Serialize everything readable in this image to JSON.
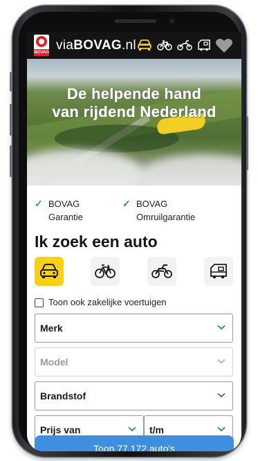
{
  "header": {
    "brand_prefix": "via",
    "brand_main": "BOVAG",
    "brand_suffix": ".nl",
    "logo_text": "BOVAG",
    "icons": [
      "car-icon",
      "bicycle-icon",
      "motorcycle-icon",
      "camper-icon",
      "heart-icon"
    ],
    "accent_color": "#f7d117"
  },
  "hero": {
    "line1": "De helpende hand",
    "line2": "van rijdend Nederland"
  },
  "usps": [
    {
      "line1": "BOVAG",
      "line2": "Garantie"
    },
    {
      "line1": "BOVAG",
      "line2": "Omruilgarantie"
    }
  ],
  "search": {
    "title": "Ik zoek een auto",
    "vehicle_types": [
      "car-icon",
      "bicycle-icon",
      "motorcycle-icon",
      "camper-icon"
    ],
    "selected_vehicle": "car-icon",
    "business_checkbox_label": "Toon ook zakelijke voertuigen",
    "fields": {
      "brand": "Merk",
      "model": "Model",
      "fuel": "Brandstof",
      "price_from": "Prijs van",
      "price_to": "t/m"
    },
    "submit_label": "Toon 77.172 auto's"
  },
  "colors": {
    "check_green": "#2f9a50",
    "cta_blue": "#3f8fe0",
    "chevron_blue": "#2a6fbf"
  }
}
